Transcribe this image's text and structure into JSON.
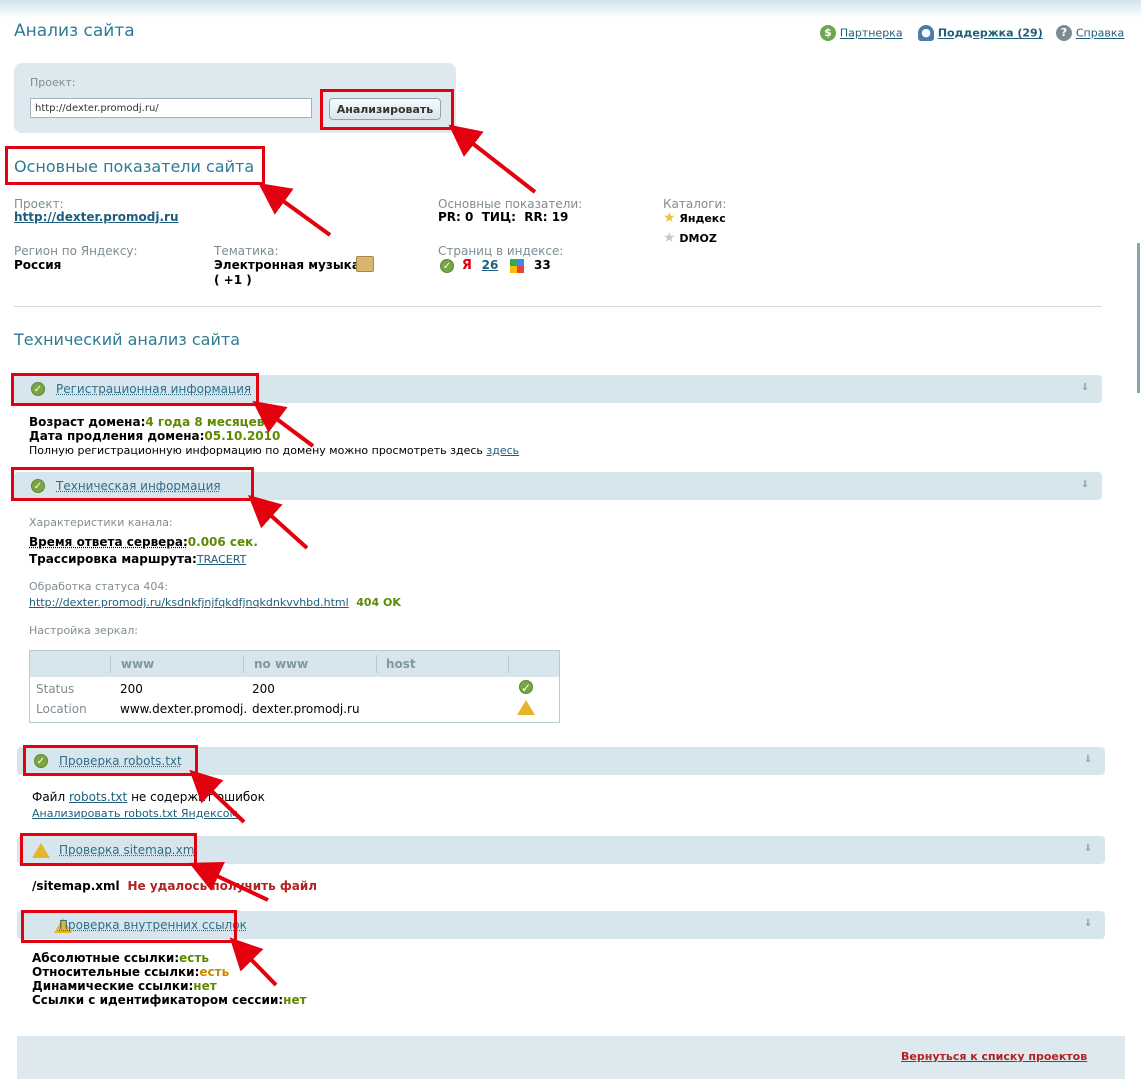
{
  "header": {
    "page_title": "Анализ сайта",
    "partner_link": "Партнерка",
    "support_link": "Поддержка (29)",
    "help_link": "Справка"
  },
  "project_form": {
    "label": "Проект:",
    "url_value": "http://dexter.promodj.ru/",
    "analyze_button": "Анализировать"
  },
  "main_indicators": {
    "heading": "Основные показатели сайта",
    "project_label": "Проект:",
    "project_link": "http://dexter.promodj.ru",
    "indicators_label": "Основные показатели:",
    "indicators_value": "PR: 0  ТИЦ:  RR: 19",
    "catalogs_label": "Каталоги:",
    "catalog_yandex": "Яндекс",
    "catalog_dmoz": "DMOZ",
    "region_label": "Регион по Яндексу:",
    "region_value": "Россия",
    "topic_label": "Тематика:",
    "topic_value": "Электронная музыка",
    "topic_extra": "( +1 )",
    "pages_label": "Страниц в индексе:",
    "yandex_pages": "26",
    "google_pages": "33"
  },
  "technical": {
    "heading": "Технический анализ сайта",
    "registration": {
      "title": "Регистрационная информация",
      "age_label": "Возраст домена:",
      "age_value": "4 года 8 месяцев",
      "renew_label": "Дата продления домена:",
      "renew_value": "05.10.2010",
      "full_info_text": "Полную регистрационную информацию по домену можно просмотреть здесь",
      "full_info_link": "здесь"
    },
    "tech_info": {
      "title": "Техническая информация",
      "channel_label": "Характеристики канала:",
      "response_label": "Время ответа сервера:",
      "response_value": "0.006 сек.",
      "trace_label": "Трассировка маршрута:",
      "trace_link": "TRACERT",
      "status404_label": "Обработка статуса 404:",
      "status404_link": "http://dexter.promodj.ru/ksdnkfjnjfqkdfjnqkdnkvvhbd.html",
      "status404_value": "404 OK",
      "mirrors_label": "Настройка зеркал:",
      "mirrors_table": {
        "columns": [
          "www",
          "no www",
          "host"
        ],
        "rows": [
          {
            "label": "Status",
            "www": "200",
            "no_www": "200",
            "host": "",
            "state": "ok"
          },
          {
            "label": "Location",
            "www": "www.dexter.promodj.",
            "no_www": "dexter.promodj.ru",
            "host": "",
            "state": "warning"
          }
        ]
      }
    },
    "robots": {
      "title": "Проверка robots.txt",
      "text_before": "Файл",
      "file_link": "robots.txt",
      "text_after": "не содержит ошибок",
      "analyze_link": "Анализировать robots.txt Яндексом"
    },
    "sitemap": {
      "title": "Проверка sitemap.xml",
      "path": "/sitemap.xml",
      "error": "Не удалось получить файл"
    },
    "internal_links": {
      "title": "Проверка внутренних ссылок",
      "items": [
        {
          "label": "Абсолютные ссылки:",
          "value": "есть"
        },
        {
          "label": "Относительные ссылки:",
          "value": "есть"
        },
        {
          "label": "Динамические ссылки:",
          "value": "нет"
        },
        {
          "label": "Ссылки с идентификатором сессии:",
          "value": "нет"
        }
      ]
    }
  },
  "footer": {
    "back_link": "Вернуться к списку проектов"
  },
  "colors": {
    "accent": "#2e7b94",
    "highlight_box": "#e3000f",
    "ok_green": "#5b8a00",
    "error_red": "#b22222"
  }
}
